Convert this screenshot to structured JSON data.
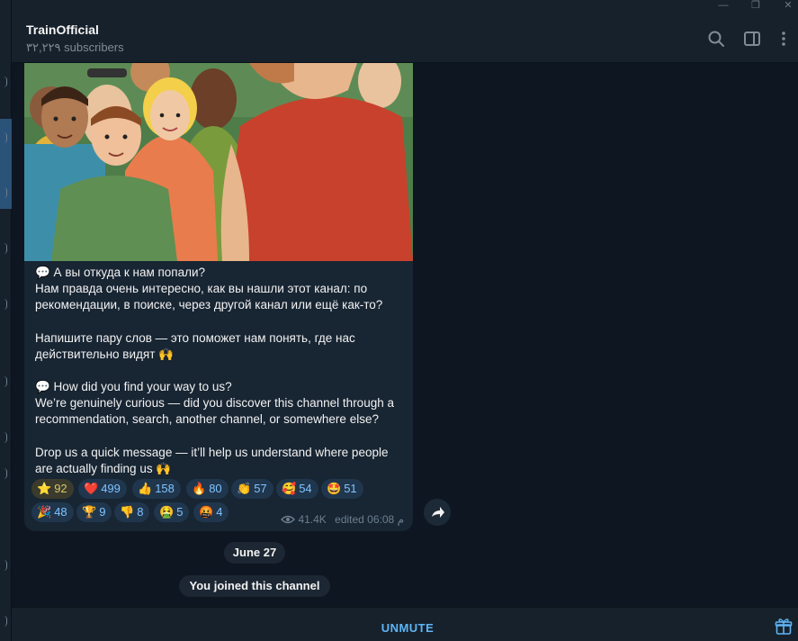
{
  "channel": {
    "title": "TrainOfficial",
    "subscribers": "۳۲,۲۲۹ subscribers"
  },
  "message": {
    "paragraphs": [
      "💬 А вы откуда к нам попали?",
      "Нам правда очень интересно, как вы нашли этот канал: по рекомендации, в поиске, через другой канал или ещё как-то?",
      "",
      "Напишите пару слов — это поможет нам понять, где нас действительно видят 🙌",
      "",
      "💬 How did you find your way to us?",
      "We’re genuinely curious — did you discover this channel through a recommendation, search, another channel, or somewhere else?",
      "",
      "Drop us a quick message — it’ll help us understand where people are actually finding us 🙌"
    ],
    "views": "41.4K",
    "edited": "edited 06:08 م"
  },
  "reactions": [
    {
      "emoji": "⭐",
      "count": "92",
      "mine": true
    },
    {
      "emoji": "❤️",
      "count": "499"
    },
    {
      "emoji": "👍",
      "count": "158"
    },
    {
      "emoji": "🔥",
      "count": "80"
    },
    {
      "emoji": "👏",
      "count": "57"
    },
    {
      "emoji": "🥰",
      "count": "54"
    },
    {
      "emoji": "🤩",
      "count": "51"
    },
    {
      "emoji": "🎉",
      "count": "48"
    },
    {
      "emoji": "🏆",
      "count": "9"
    },
    {
      "emoji": "👎",
      "count": "8"
    },
    {
      "emoji": "🤮",
      "count": "5"
    },
    {
      "emoji": "🤬",
      "count": "4"
    }
  ],
  "service": {
    "date": "June 27",
    "joined": "You joined this channel"
  },
  "bottom": {
    "unmute": "UNMUTE"
  },
  "icons": {
    "search": "search-icon",
    "sidebar": "sidebar-toggle-icon",
    "more": "more-vertical-icon",
    "share": "share-arrow-icon",
    "gift": "gift-icon",
    "views": "eye-icon"
  },
  "colors": {
    "accent": "#5eb5f7",
    "bubble": "#182533",
    "background": "#0e1621",
    "reaction": "#20364d"
  }
}
